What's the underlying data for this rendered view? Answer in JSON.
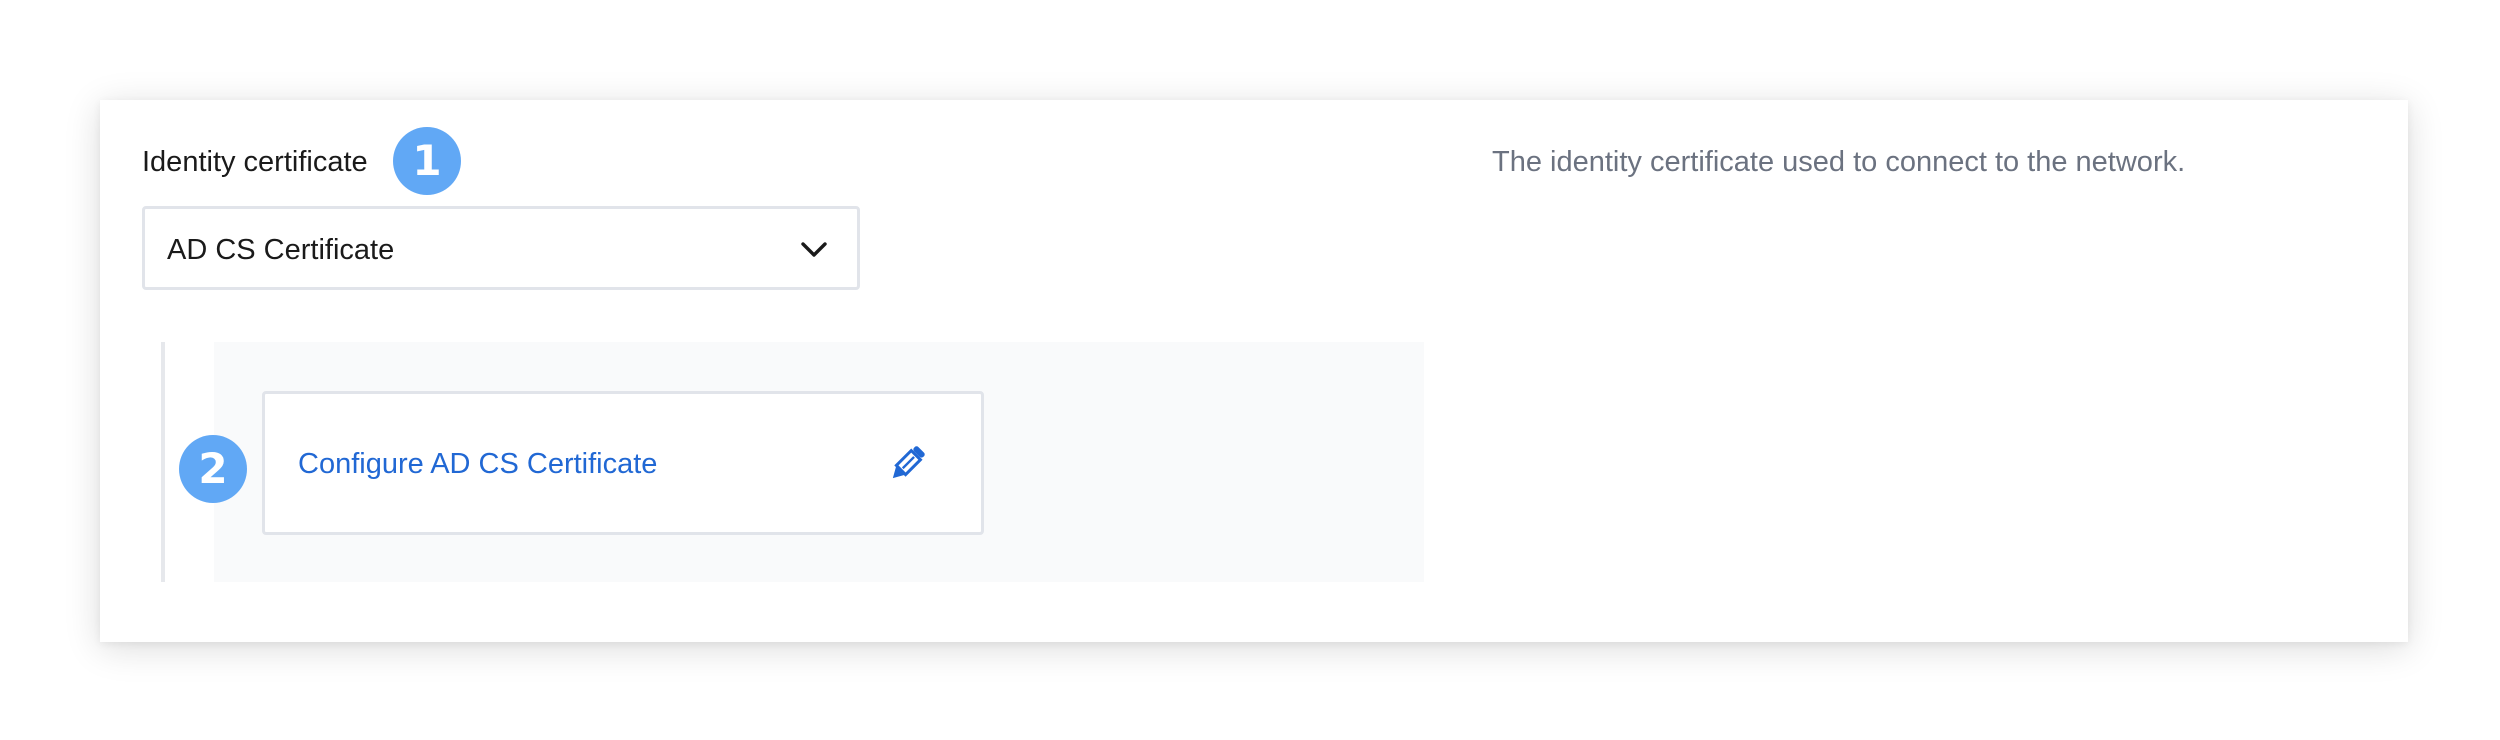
{
  "identity_certificate": {
    "label": "Identity certificate",
    "callout_number": "1",
    "selected_value": "AD CS Certificate",
    "help_text": "The identity certificate used to connect to the network."
  },
  "configure": {
    "callout_number": "2",
    "link_label": "Configure AD CS Certificate",
    "icon": "pencil-icon"
  },
  "colors": {
    "callout": "#61a8f5",
    "link": "#2168d4",
    "border": "#e1e4ea",
    "muted_text": "#6b7280"
  }
}
